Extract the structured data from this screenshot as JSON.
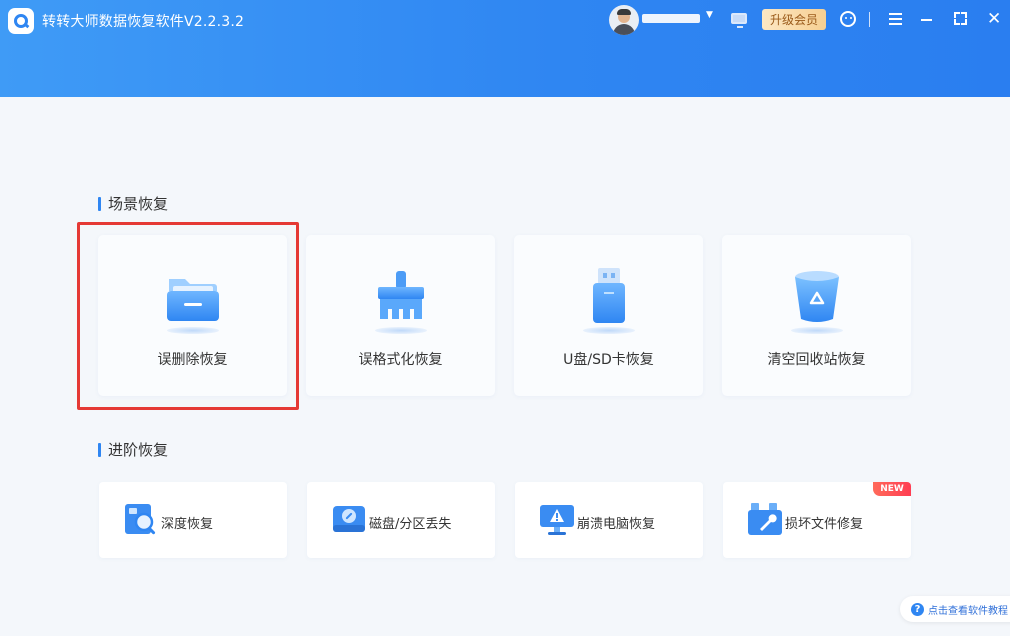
{
  "app": {
    "title": "转转大师数据恢复软件V2.2.3.2"
  },
  "header": {
    "upgrade_label": "升级会员",
    "user_caret": "▼",
    "close_glyph": "✕"
  },
  "sections": {
    "scene": {
      "title": "场景恢复",
      "cards": [
        {
          "label": "误删除恢复",
          "icon": "folder-icon"
        },
        {
          "label": "误格式化恢复",
          "icon": "broom-icon"
        },
        {
          "label": "U盘/SD卡恢复",
          "icon": "usb-drive-icon"
        },
        {
          "label": "清空回收站恢复",
          "icon": "recycle-bin-icon"
        }
      ]
    },
    "advanced": {
      "title": "进阶恢复",
      "cards": [
        {
          "label": "深度恢复",
          "icon": "deep-scan-icon"
        },
        {
          "label": "磁盘/分区丢失",
          "icon": "disk-icon"
        },
        {
          "label": "崩溃电脑恢复",
          "icon": "crashed-computer-icon"
        },
        {
          "label": "损坏文件修复",
          "icon": "repair-toolbox-icon"
        }
      ],
      "new_badge": "NEW"
    }
  },
  "help": {
    "label": "点击查看软件教程",
    "glyph": "?"
  },
  "colors": {
    "accent": "#2f86f2",
    "highlight": "#e53935"
  }
}
